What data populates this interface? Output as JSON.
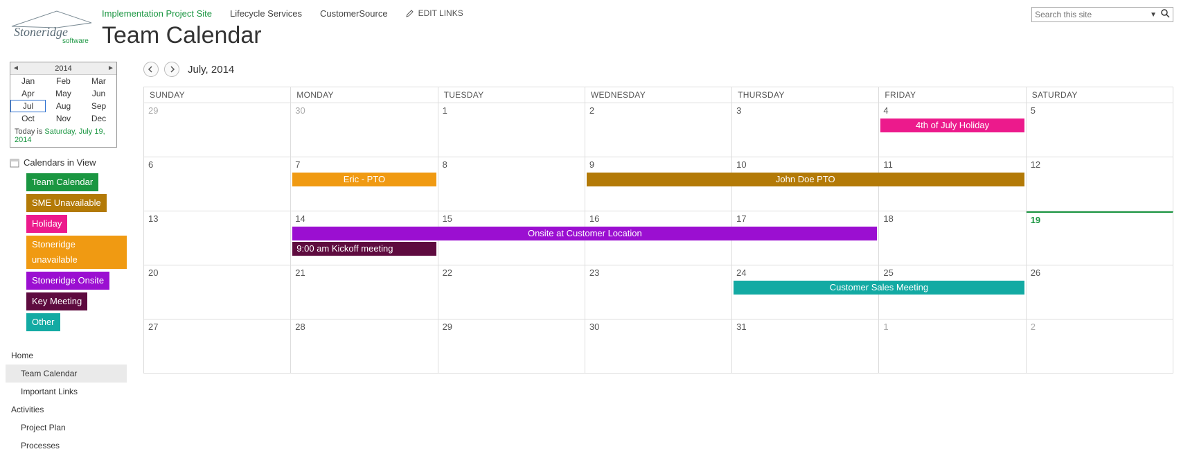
{
  "header": {
    "nav": {
      "impl": "Implementation Project Site",
      "lcs": "Lifecycle Services",
      "cs": "CustomerSource",
      "edit": "EDIT LINKS"
    },
    "title": "Team Calendar",
    "search_placeholder": "Search this site"
  },
  "yearpicker": {
    "year": "2014",
    "months": [
      "Jan",
      "Feb",
      "Mar",
      "Apr",
      "May",
      "Jun",
      "Jul",
      "Aug",
      "Sep",
      "Oct",
      "Nov",
      "Dec"
    ],
    "selected": "Jul",
    "today_prefix": "Today is ",
    "today_date": "Saturday, July 19, 2014"
  },
  "civ_title": "Calendars in View",
  "legend": [
    {
      "label": "Team Calendar",
      "color": "c-green"
    },
    {
      "label": "SME Unavailable",
      "color": "c-darkorange"
    },
    {
      "label": "Holiday",
      "color": "c-pink"
    },
    {
      "label": "Stoneridge unavailable",
      "color": "c-orange"
    },
    {
      "label": "Stoneridge Onsite",
      "color": "c-purple"
    },
    {
      "label": "Key Meeting",
      "color": "c-maroon"
    },
    {
      "label": "Other",
      "color": "c-teal"
    }
  ],
  "leftnav": [
    {
      "label": "Home",
      "lvl": 0
    },
    {
      "label": "Team Calendar",
      "lvl": 1,
      "sel": true
    },
    {
      "label": "Important Links",
      "lvl": 1
    },
    {
      "label": "Activities",
      "lvl": 0
    },
    {
      "label": "Project Plan",
      "lvl": 1
    },
    {
      "label": "Processes",
      "lvl": 1
    }
  ],
  "cal": {
    "month_label": "July, 2014",
    "daynames": [
      "SUNDAY",
      "MONDAY",
      "TUESDAY",
      "WEDNESDAY",
      "THURSDAY",
      "FRIDAY",
      "SATURDAY"
    ],
    "weeks": [
      [
        {
          "n": "29",
          "out": true
        },
        {
          "n": "30",
          "out": true
        },
        {
          "n": "1"
        },
        {
          "n": "2"
        },
        {
          "n": "3"
        },
        {
          "n": "4",
          "events": [
            {
              "row": 1,
              "color": "c-pink",
              "text": "4th of July Holiday",
              "span": 1
            }
          ]
        },
        {
          "n": "5"
        }
      ],
      [
        {
          "n": "6"
        },
        {
          "n": "7",
          "events": [
            {
              "row": 1,
              "color": "c-orange",
              "text": "Eric - PTO",
              "span": 1
            }
          ]
        },
        {
          "n": "8"
        },
        {
          "n": "9",
          "events": [
            {
              "row": 1,
              "color": "c-darkorange",
              "text": "John Doe PTO",
              "span": 3
            }
          ]
        },
        {
          "n": "10"
        },
        {
          "n": "11"
        },
        {
          "n": "12"
        }
      ],
      [
        {
          "n": "13"
        },
        {
          "n": "14",
          "events": [
            {
              "row": 1,
              "color": "c-purple",
              "text": "Onsite at Customer Location",
              "span": 4
            },
            {
              "row": 2,
              "color": "c-maroon",
              "text": "9:00 am Kickoff meeting",
              "span": 1,
              "align": "left"
            }
          ]
        },
        {
          "n": "15"
        },
        {
          "n": "16"
        },
        {
          "n": "17"
        },
        {
          "n": "18"
        },
        {
          "n": "19",
          "today": true
        }
      ],
      [
        {
          "n": "20"
        },
        {
          "n": "21"
        },
        {
          "n": "22"
        },
        {
          "n": "23"
        },
        {
          "n": "24",
          "events": [
            {
              "row": 1,
              "color": "c-teal",
              "text": "Customer Sales Meeting",
              "span": 2
            }
          ]
        },
        {
          "n": "25"
        },
        {
          "n": "26"
        }
      ],
      [
        {
          "n": "27"
        },
        {
          "n": "28"
        },
        {
          "n": "29"
        },
        {
          "n": "30"
        },
        {
          "n": "31"
        },
        {
          "n": "1",
          "out": true
        },
        {
          "n": "2",
          "out": true
        }
      ]
    ]
  }
}
